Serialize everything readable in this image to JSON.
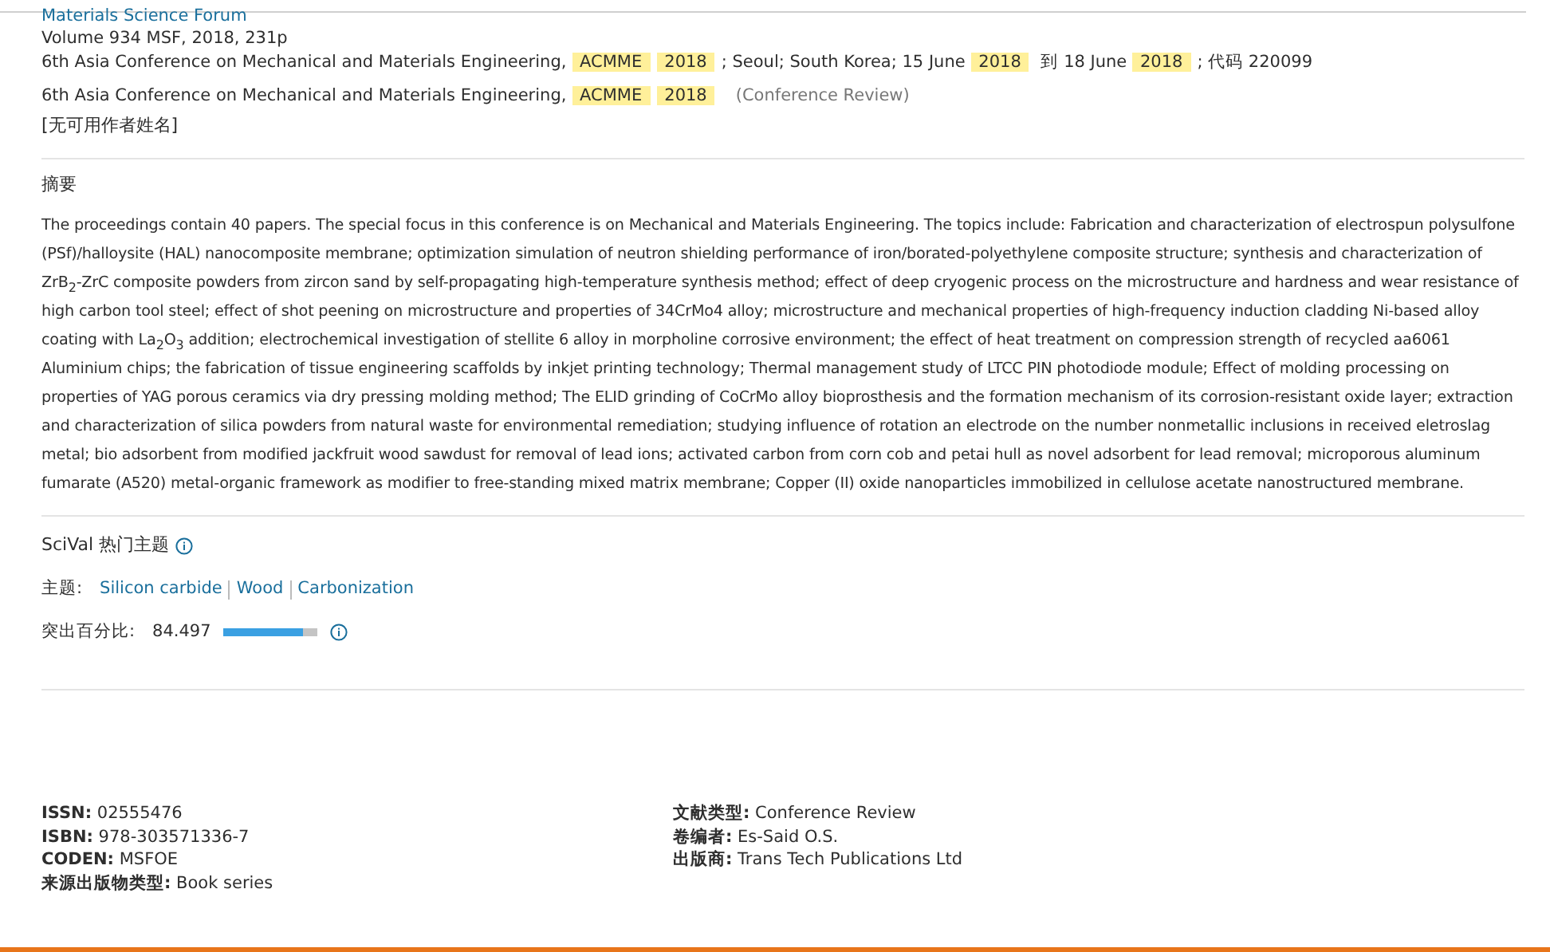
{
  "source": {
    "journal": "Materials Science Forum",
    "volume": "Volume 934 MSF, 2018, 231p",
    "conference_line": [
      {
        "text": "6th Asia Conference on Mechanical and Materials Engineering, ",
        "highlight": false
      },
      {
        "text": "ACMME",
        "highlight": true
      },
      {
        "text": "2018",
        "highlight": true
      },
      {
        "text": "; Seoul; South Korea; 15 June ",
        "highlight": false
      },
      {
        "text": "2018",
        "highlight": true
      },
      {
        "text": " 到 18 June ",
        "highlight": false
      },
      {
        "text": "2018",
        "highlight": true
      },
      {
        "text": "; 代码 220099",
        "highlight": false
      }
    ],
    "title_line": [
      {
        "text": "6th Asia Conference on Mechanical and Materials Engineering, ",
        "highlight": false
      },
      {
        "text": "ACMME",
        "highlight": true
      },
      {
        "text": "2018",
        "highlight": true
      }
    ],
    "doc_type_tag": "(Conference Review)",
    "authors": "[无可用作者姓名]"
  },
  "abstract": {
    "heading": "摘要",
    "text": "The proceedings contain 40 papers. The special focus in this conference is on Mechanical and Materials Engineering. The topics include: Fabrication and characterization of electrospun polysulfone (PSf)/halloysite (HAL) nanocomposite membrane; optimization simulation of neutron shielding performance of iron/borated-polyethylene composite structure; synthesis and characterization of ZrB$_{2}$-ZrC composite powders from zircon sand by self-propagating high-temperature synthesis method; effect of deep cryogenic process on the microstructure and hardness and wear resistance of high carbon tool steel; effect of shot peening on microstructure and properties of 34CrMo4 alloy; microstructure and mechanical properties of high-frequency induction cladding Ni-based alloy coating with La$_{2}$O$_{3}$ addition; electrochemical investigation of stellite 6 alloy in morpholine corrosive environment; the effect of heat treatment on compression strength of recycled aa6061 Aluminium chips; the fabrication of tissue engineering scaffolds by inkjet printing technology; Thermal management study of LTCC PIN photodiode module; Effect of molding processing on properties of YAG porous ceramics via dry pressing molding method; The ELID grinding of CoCrMo alloy bioprosthesis and the formation mechanism of its corrosion-resistant oxide layer; extraction and characterization of silica powders from natural waste for environmental remediation; studying influence of rotation an electrode on the number nonmetallic inclusions in received eletroslag metal; bio adsorbent from modified jackfruit wood sawdust for removal of lead ions; activated carbon from corn cob and petai hull as novel adsorbent for lead removal; microporous aluminum fumarate (A520) metal-organic framework as modifier to free-standing mixed matrix membrane; Copper (II) oxide nanoparticles immobilized in cellulose acetate nanostructured membrane."
  },
  "scival": {
    "heading": "SciVal 热门主题",
    "topics_label": "主题:",
    "topics": [
      "Silicon carbide",
      "Wood",
      "Carbonization"
    ],
    "prominence_label": "突出百分比:",
    "prominence_value": "84.497",
    "level": 0.845
  },
  "details": {
    "left": [
      {
        "label": "ISSN:",
        "value": "02555476"
      },
      {
        "label": "ISBN:",
        "value": "978-303571336-7"
      },
      {
        "label": "CODEN:",
        "value": "MSFOE"
      },
      {
        "label": "来源出版物类型:",
        "value": "Book series"
      }
    ],
    "right": [
      {
        "label": "文献类型:",
        "value": "Conference Review"
      },
      {
        "label": "卷编者:",
        "value": "Es-Said O.S."
      },
      {
        "label": "出版商:",
        "value": "Trans Tech Publications Ltd"
      }
    ]
  }
}
